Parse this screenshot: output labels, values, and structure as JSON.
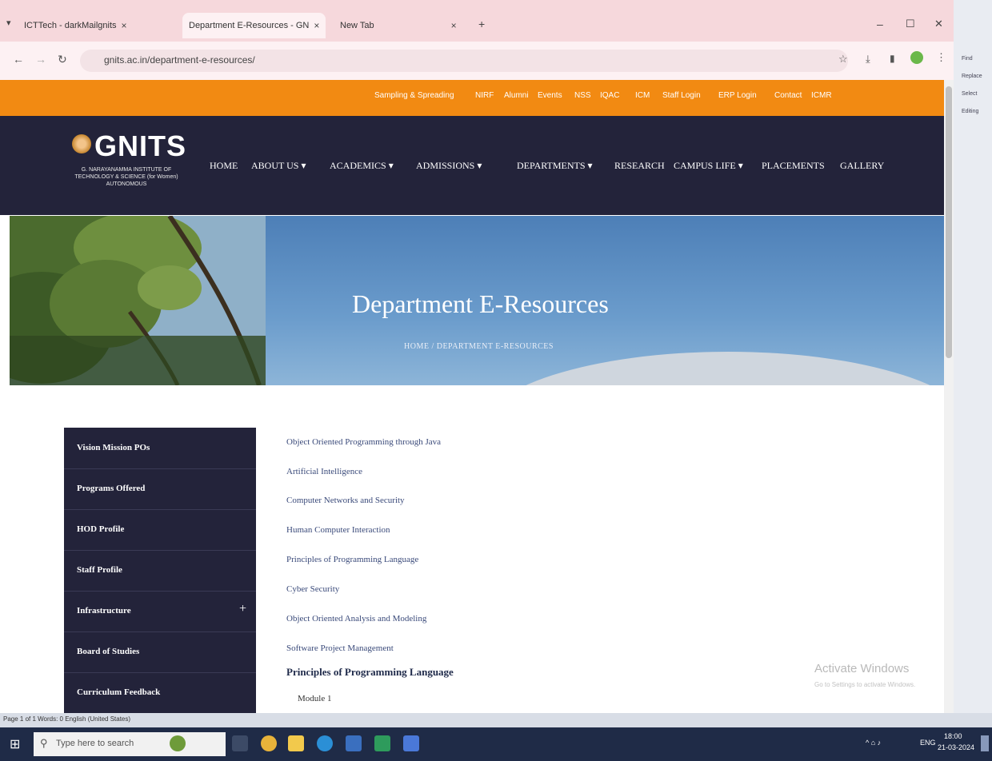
{
  "browser": {
    "tabs": [
      {
        "label": "ICTTech - darkMailgnits",
        "close": "×"
      },
      {
        "label": "Department E-Resources - GN",
        "close": "×"
      },
      {
        "label": "New Tab",
        "close": "×"
      }
    ],
    "new_tab": "+",
    "window_controls": [
      "–",
      "☐",
      "✕"
    ],
    "url": "gnits.ac.in/department-e-resources/",
    "nav": {
      "back": "←",
      "forward": "→",
      "reload": "↻"
    }
  },
  "top_links": [
    "Sampling & Spreading",
    "NIRF",
    "Alumni",
    "Events",
    "NSS",
    "IQAC",
    "ICM",
    "Staff Login",
    "ERP Login",
    "Contact",
    "ICMR"
  ],
  "logo": {
    "name": "GNITS",
    "subtitle": "G. NARAYANAMMA INSTITUTE OF TECHNOLOGY & SCIENCE (for Women) AUTONOMOUS"
  },
  "menu": [
    {
      "label": "HOME",
      "dropdown": ""
    },
    {
      "label": "ABOUT US",
      "dropdown": "▾"
    },
    {
      "label": "ACADEMICS",
      "dropdown": "▾"
    },
    {
      "label": "ADMISSIONS",
      "dropdown": "▾"
    },
    {
      "label": "DEPARTMENTS",
      "dropdown": "▾"
    },
    {
      "label": "RESEARCH",
      "dropdown": ""
    },
    {
      "label": "CAMPUS LIFE",
      "dropdown": "▾"
    },
    {
      "label": "PLACEMENTS",
      "dropdown": ""
    },
    {
      "label": "GALLERY",
      "dropdown": ""
    }
  ],
  "banner": {
    "title": "Department E-Resources",
    "breadcrumb": "HOME / DEPARTMENT E-RESOURCES"
  },
  "sidebar": {
    "items": [
      {
        "label": "Vision Mission POs"
      },
      {
        "label": "Programs Offered"
      },
      {
        "label": "HOD Profile"
      },
      {
        "label": "Staff Profile"
      },
      {
        "label": "Infrastructure",
        "expand": "+"
      },
      {
        "label": "Board of Studies"
      },
      {
        "label": "Curriculum Feedback"
      }
    ]
  },
  "resources": [
    "Object Oriented Programming through Java",
    "Artificial Intelligence",
    "Computer Networks and Security",
    "Human Computer Interaction",
    "Principles of Programming Language",
    "Cyber Security",
    "Object Oriented Analysis and Modeling",
    "Software Project Management"
  ],
  "section": {
    "heading": "Principles of Programming Language",
    "module": "Module 1"
  },
  "watermark": {
    "title": "Activate Windows",
    "sub": "Go to Settings to activate Windows."
  },
  "word": {
    "lines": [
      "Find",
      "Replace",
      "Select",
      "Editing"
    ],
    "status": "Page 1 of 1   Words: 0   English (United States)"
  },
  "taskbar": {
    "search_placeholder": "Type here to search",
    "time": "18:00",
    "date": "21-03-2024",
    "lang": "ENG"
  }
}
